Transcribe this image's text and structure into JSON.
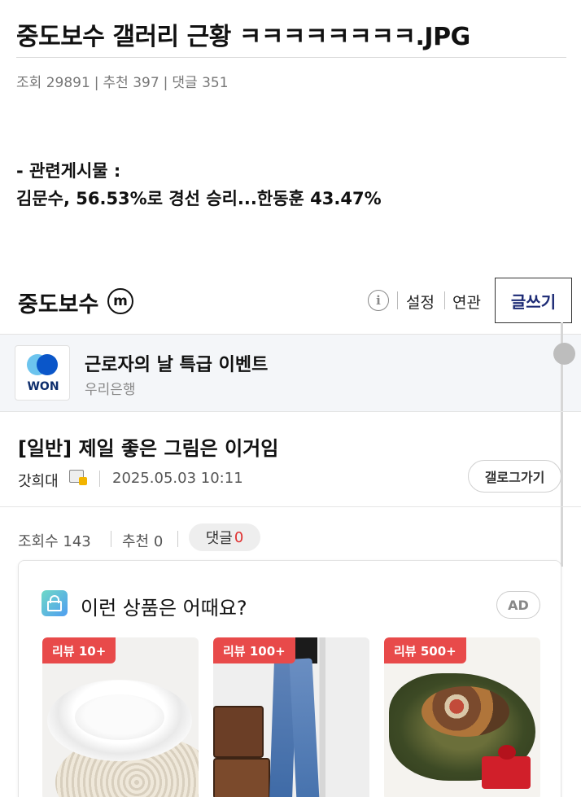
{
  "post": {
    "title": "중도보수 갤러리 근황 ㅋㅋㅋㅋㅋㅋㅋㅋ.JPG",
    "stats": {
      "views_label": "조회",
      "views": "29891",
      "recommend_label": "추천",
      "recommend": "397",
      "comments_label": "댓글",
      "comments": "351",
      "separator": "|"
    },
    "body_lines": [
      "- 관련게시물 :",
      "김문수, 56.53%로 경선 승리...한동훈 43.47%"
    ]
  },
  "embed": {
    "header": {
      "gallery_name": "중도보수",
      "minor_badge": "m",
      "info_icon": "i",
      "links": [
        "설정",
        "연관"
      ],
      "write_button": "글쓰기"
    },
    "ad_banner": {
      "logo_text": "WON",
      "title": "근로자의 날 특급 이벤트",
      "advertiser": "우리은행"
    },
    "article": {
      "title": "[일반] 제일 좋은 그림은 이거임",
      "author": "갓희대",
      "date": "2025.05.03 10:11",
      "back_button": "갤로그가기",
      "views_label": "조회수 143",
      "recommend_label": "추천 0",
      "comments_label": "댓글",
      "comments_count": "0"
    },
    "product_card": {
      "title": "이런 상품은 어때요?",
      "ad_label": "AD",
      "products": [
        {
          "review_tag": "리뷰 10+",
          "image": "white-plates"
        },
        {
          "review_tag": "리뷰 100+",
          "image": "denim-jeans"
        },
        {
          "review_tag": "리뷰 500+",
          "image": "korean-food-gift"
        }
      ]
    }
  },
  "colors": {
    "write_button_text": "#1c2a75",
    "review_tag": "#e84a4a",
    "comment_count": "#e03030"
  }
}
